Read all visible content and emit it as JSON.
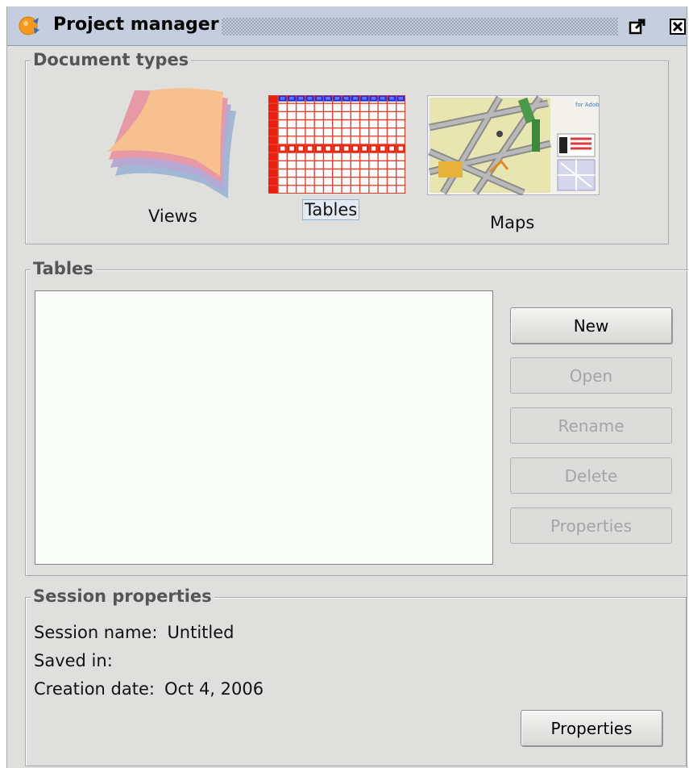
{
  "window": {
    "title": "Project manager",
    "float_icon": "float-window-icon",
    "close_icon": "close-window-icon",
    "logo_icon": "gvsig-logo-icon"
  },
  "document_types": {
    "title": "Document types",
    "items": [
      {
        "label": "Views",
        "icon": "views-icon",
        "selected": false
      },
      {
        "label": "Tables",
        "icon": "tables-icon",
        "selected": true
      },
      {
        "label": "Maps",
        "icon": "maps-icon",
        "selected": false
      }
    ],
    "map_thumbnail_text": "for Adobe"
  },
  "tables_panel": {
    "title": "Tables",
    "list_items": [],
    "buttons": {
      "new": {
        "label": "New",
        "enabled": true
      },
      "open": {
        "label": "Open",
        "enabled": false
      },
      "rename": {
        "label": "Rename",
        "enabled": false
      },
      "delete": {
        "label": "Delete",
        "enabled": false
      },
      "properties": {
        "label": "Properties",
        "enabled": false
      }
    }
  },
  "session": {
    "title": "Session properties",
    "name_label": "Session name:",
    "name_value": "Untitled",
    "saved_label": "Saved in:",
    "saved_value": "",
    "date_label": "Creation date:",
    "date_value": "Oct 4, 2006",
    "properties_button": "Properties"
  },
  "colors": {
    "window_bg": "#dfdfdd",
    "titlebar_bg": "#c4cede",
    "disabled_text": "#a5a5a5",
    "selection_border": "#8fb1da"
  }
}
